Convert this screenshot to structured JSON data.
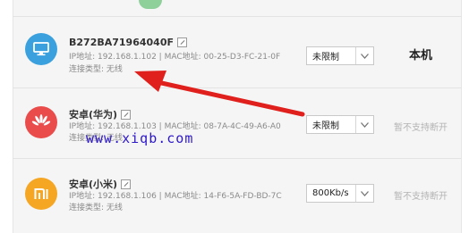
{
  "devices": [
    {
      "name": "B272BA71964040F",
      "ip_line": "IP地址: 192.168.1.102 | MAC地址: 00-25-D3-FC-21-0F",
      "conn_line": "连接类型: 无线",
      "speed": "未限制",
      "action": "本机",
      "icon": "monitor-icon",
      "color": "#3aa1de"
    },
    {
      "name": "安卓(华为)",
      "ip_line": "IP地址: 192.168.1.103 | MAC地址: 08-7A-4C-49-A6-A0",
      "conn_line": "连接类型: 无线",
      "speed": "未限制",
      "action": "暂不支持断开",
      "icon": "huawei-logo-icon",
      "color": "#ea4b4b"
    },
    {
      "name": "安卓(小米)",
      "ip_line": "IP地址: 192.168.1.106 | MAC地址: 14-F6-5A-FD-BD-7C",
      "conn_line": "连接类型: 无线",
      "speed": "800Kb/s",
      "action": "暂不支持断开",
      "icon": "xiaomi-logo-icon",
      "color": "#f5a623"
    }
  ],
  "watermark": "www.xiqb.com",
  "annotation_color": "#e0201c"
}
